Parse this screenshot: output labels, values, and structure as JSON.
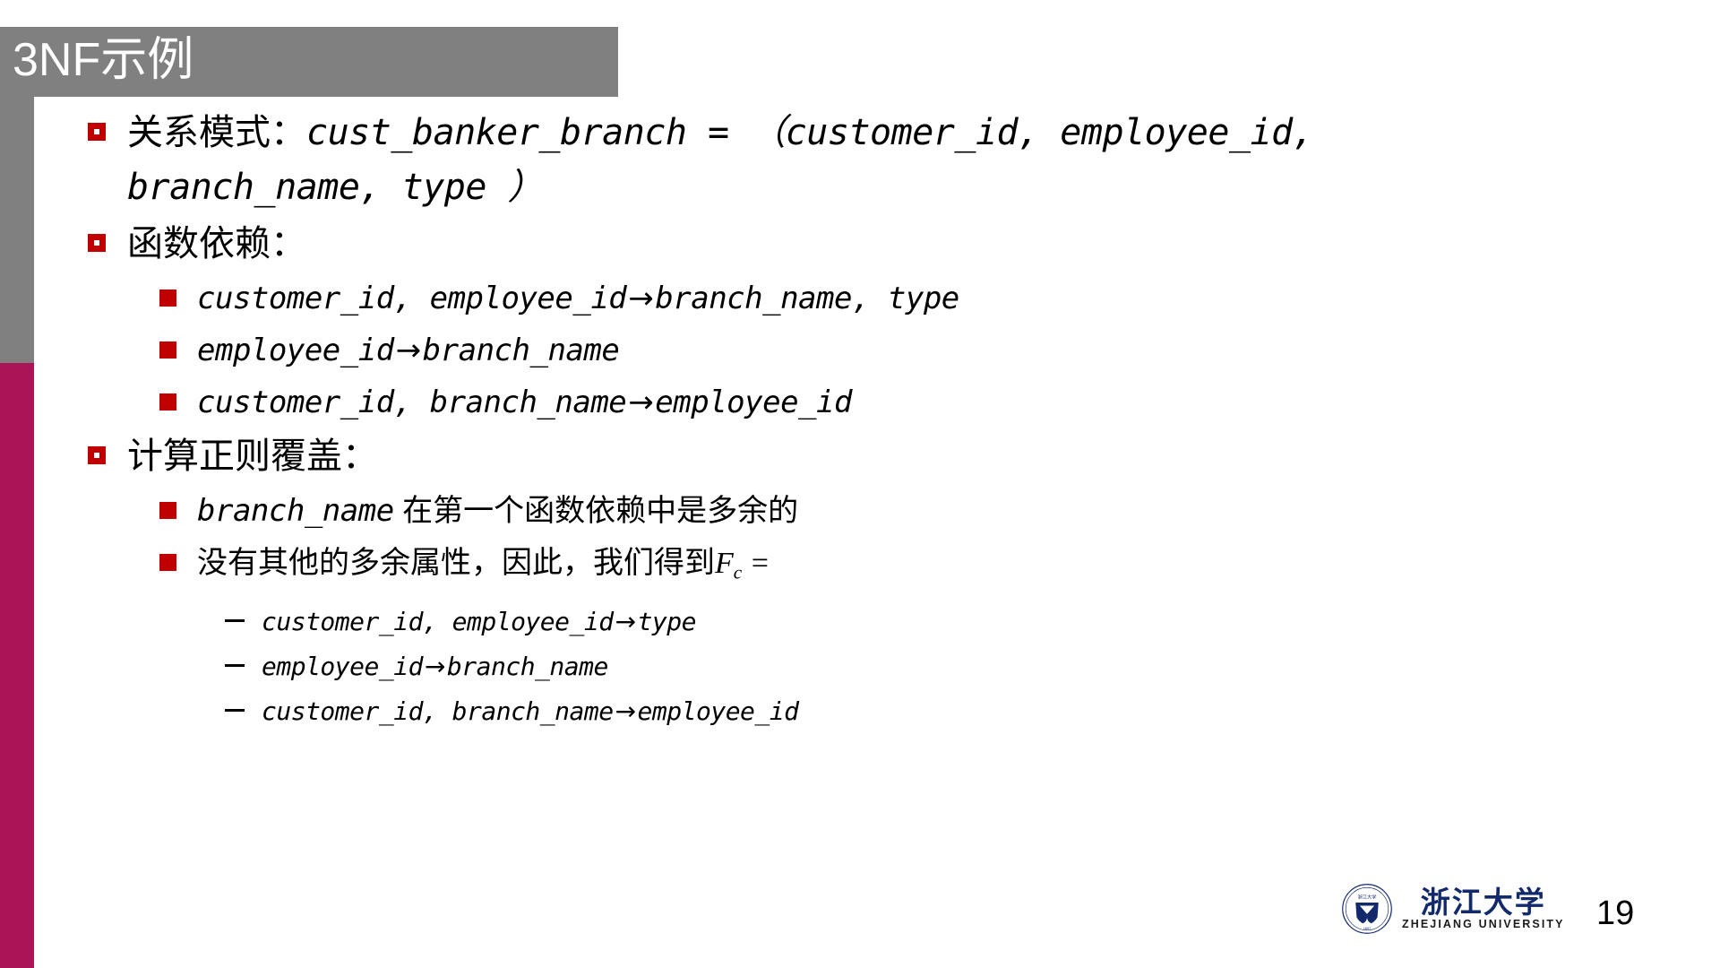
{
  "slide": {
    "title": "3NF示例",
    "page_number": "19",
    "accent_gray": "#808080",
    "accent_crimson": "#ab1457",
    "bullet_red": "#c00000"
  },
  "bullets": {
    "b1_label": "关系模式：",
    "b1_code_line1": "cust_banker_branch = （customer_id, employee_id,",
    "b1_code_line2": "branch_name, type ）",
    "b2_label": "函数依赖：",
    "b2_items": [
      {
        "left": "customer_id, employee_id",
        "arrow": "→",
        "right": "branch_name, type"
      },
      {
        "left": "employee_id",
        "arrow": "→",
        "right": "branch_name"
      },
      {
        "left": "customer_id, branch_name",
        "arrow": "→",
        "right": "employee_id"
      }
    ],
    "b3_label": "计算正则覆盖：",
    "b3_item1_code": "branch_name",
    "b3_item1_text": " 在第一个函数依赖中是多余的",
    "b3_item2_text": "没有其他的多余属性，因此，我们得到",
    "b3_item2_var": "F",
    "b3_item2_sub": "c",
    "b3_item2_eq": " =",
    "b3_subitems": [
      {
        "left": "customer_id, employee_id",
        "arrow": "→",
        "right": "type"
      },
      {
        "left": "employee_id",
        "arrow": "→",
        "right": "branch_name"
      },
      {
        "left": "customer_id, branch_name",
        "arrow": "→",
        "right": "employee_id"
      }
    ]
  },
  "footer": {
    "logo_cn": "浙江大学",
    "logo_en": "ZHEJIANG UNIVERSITY",
    "seal_text": "ZHEJIANG UNIVERSITY"
  }
}
